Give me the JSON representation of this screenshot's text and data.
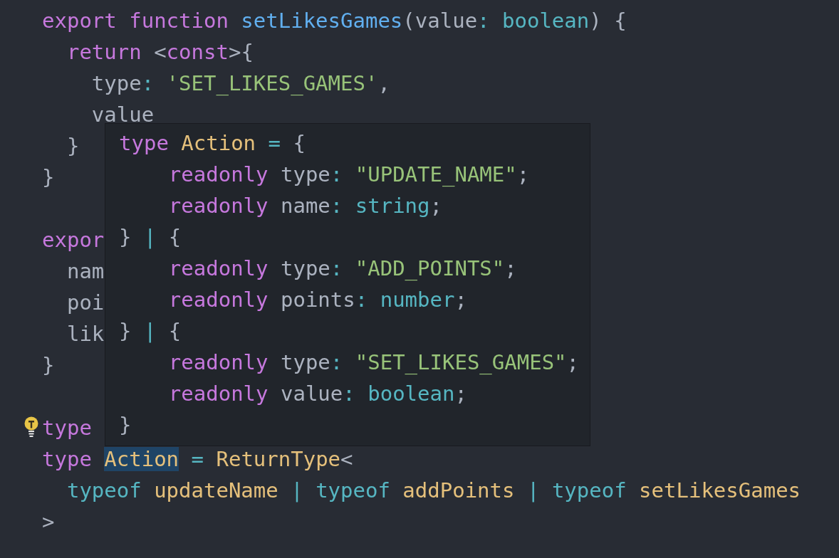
{
  "editor": {
    "lines": [
      {
        "kind": "code",
        "tokens": [
          {
            "text": "export ",
            "kind": "kw"
          },
          {
            "text": "function ",
            "kind": "kw"
          },
          {
            "text": "setLikesGames",
            "kind": "fn"
          },
          {
            "text": "(value",
            "kind": "plain"
          },
          {
            "text": ": ",
            "kind": "op"
          },
          {
            "text": "boolean",
            "kind": "builtin"
          },
          {
            "text": ") {",
            "kind": "plain"
          }
        ]
      },
      {
        "kind": "code",
        "tokens": [
          {
            "text": "  return ",
            "kind": "kw"
          },
          {
            "text": "<",
            "kind": "plain"
          },
          {
            "text": "const",
            "kind": "kw"
          },
          {
            "text": ">{",
            "kind": "plain"
          }
        ]
      },
      {
        "kind": "code",
        "tokens": [
          {
            "text": "    type",
            "kind": "plain"
          },
          {
            "text": ": ",
            "kind": "op"
          },
          {
            "text": "'SET_LIKES_GAMES'",
            "kind": "str"
          },
          {
            "text": ",",
            "kind": "plain"
          }
        ]
      },
      {
        "kind": "code",
        "tokens": [
          {
            "text": "    value",
            "kind": "plain"
          }
        ]
      },
      {
        "kind": "code",
        "tokens": [
          {
            "text": "  }",
            "kind": "plain"
          }
        ]
      },
      {
        "kind": "code",
        "tokens": [
          {
            "text": "}",
            "kind": "plain"
          }
        ]
      },
      {
        "kind": "blank"
      },
      {
        "kind": "code",
        "tokens": [
          {
            "text": "expor",
            "kind": "kw"
          }
        ]
      },
      {
        "kind": "code",
        "tokens": [
          {
            "text": "  nam",
            "kind": "plain"
          }
        ]
      },
      {
        "kind": "code",
        "tokens": [
          {
            "text": "  poi",
            "kind": "plain"
          }
        ]
      },
      {
        "kind": "code",
        "tokens": [
          {
            "text": "  lik",
            "kind": "plain"
          }
        ]
      },
      {
        "kind": "code",
        "tokens": [
          {
            "text": "}",
            "kind": "plain"
          }
        ]
      },
      {
        "kind": "blank"
      },
      {
        "kind": "code",
        "tokens": [
          {
            "text": "type",
            "kind": "kw"
          }
        ]
      },
      {
        "kind": "code",
        "tokens": [
          {
            "text": "type ",
            "kind": "kw",
            "highlighted": false
          },
          {
            "text": "Action",
            "kind": "type",
            "highlighted": true
          },
          {
            "text": " = ",
            "kind": "op",
            "highlighted": false
          },
          {
            "text": "ReturnType",
            "kind": "type",
            "highlighted": false
          },
          {
            "text": "<",
            "kind": "plain",
            "highlighted": false
          }
        ]
      },
      {
        "kind": "code",
        "tokens": [
          {
            "text": "  typeof ",
            "kind": "builtin"
          },
          {
            "text": "updateName",
            "kind": "type"
          },
          {
            "text": " | ",
            "kind": "op"
          },
          {
            "text": "typeof ",
            "kind": "builtin"
          },
          {
            "text": "addPoints",
            "kind": "type"
          },
          {
            "text": " | ",
            "kind": "op"
          },
          {
            "text": "typeof ",
            "kind": "builtin"
          },
          {
            "text": "setLikesGames",
            "kind": "type"
          }
        ]
      },
      {
        "kind": "code",
        "tokens": [
          {
            "text": ">",
            "kind": "plain"
          }
        ]
      }
    ]
  },
  "tooltip": {
    "lines": [
      [
        {
          "text": "type ",
          "kind": "kw"
        },
        {
          "text": "Action",
          "kind": "type"
        },
        {
          "text": " = ",
          "kind": "op"
        },
        {
          "text": "{",
          "kind": "plain"
        }
      ],
      [
        {
          "text": "    readonly ",
          "kind": "kw"
        },
        {
          "text": "type",
          "kind": "plain"
        },
        {
          "text": ": ",
          "kind": "op"
        },
        {
          "text": "\"UPDATE_NAME\"",
          "kind": "str"
        },
        {
          "text": ";",
          "kind": "plain"
        }
      ],
      [
        {
          "text": "    readonly ",
          "kind": "kw"
        },
        {
          "text": "name",
          "kind": "plain"
        },
        {
          "text": ": ",
          "kind": "op"
        },
        {
          "text": "string",
          "kind": "builtin"
        },
        {
          "text": ";",
          "kind": "plain"
        }
      ],
      [
        {
          "text": "} ",
          "kind": "plain"
        },
        {
          "text": "|",
          "kind": "op"
        },
        {
          "text": " {",
          "kind": "plain"
        }
      ],
      [
        {
          "text": "    readonly ",
          "kind": "kw"
        },
        {
          "text": "type",
          "kind": "plain"
        },
        {
          "text": ": ",
          "kind": "op"
        },
        {
          "text": "\"ADD_POINTS\"",
          "kind": "str"
        },
        {
          "text": ";",
          "kind": "plain"
        }
      ],
      [
        {
          "text": "    readonly ",
          "kind": "kw"
        },
        {
          "text": "points",
          "kind": "plain"
        },
        {
          "text": ": ",
          "kind": "op"
        },
        {
          "text": "number",
          "kind": "builtin"
        },
        {
          "text": ";",
          "kind": "plain"
        }
      ],
      [
        {
          "text": "} ",
          "kind": "plain"
        },
        {
          "text": "|",
          "kind": "op"
        },
        {
          "text": " {",
          "kind": "plain"
        }
      ],
      [
        {
          "text": "    readonly ",
          "kind": "kw"
        },
        {
          "text": "type",
          "kind": "plain"
        },
        {
          "text": ": ",
          "kind": "op"
        },
        {
          "text": "\"SET_LIKES_GAMES\"",
          "kind": "str"
        },
        {
          "text": ";",
          "kind": "plain"
        }
      ],
      [
        {
          "text": "    readonly ",
          "kind": "kw"
        },
        {
          "text": "value",
          "kind": "plain"
        },
        {
          "text": ": ",
          "kind": "op"
        },
        {
          "text": "boolean",
          "kind": "builtin"
        },
        {
          "text": ";",
          "kind": "plain"
        }
      ],
      [
        {
          "text": "}",
          "kind": "plain"
        }
      ]
    ]
  }
}
